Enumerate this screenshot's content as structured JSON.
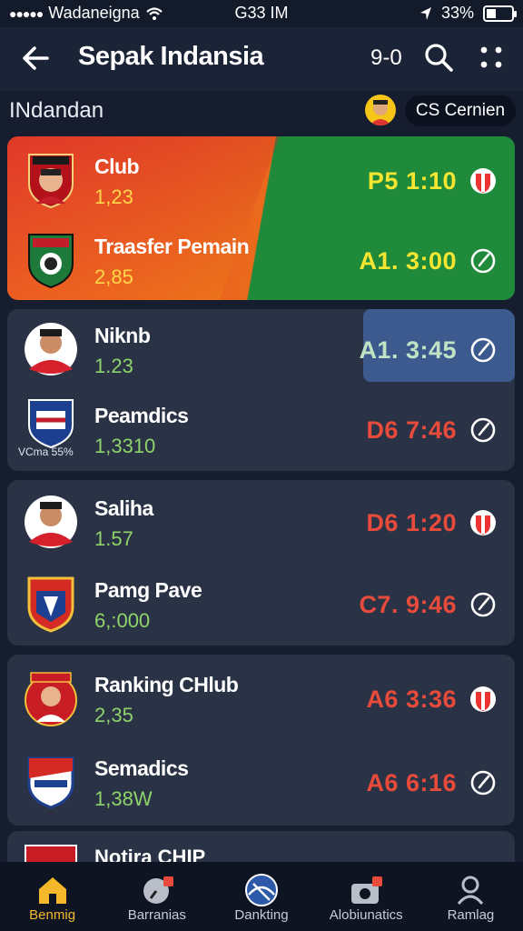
{
  "status_bar": {
    "carrier": "Wadaneigna",
    "time": "G33 IM",
    "battery": "33%"
  },
  "header": {
    "title": "Sepak Indansia",
    "score_chip": "9-0",
    "back_icon": "arrow-left-icon",
    "search_icon": "search-icon",
    "more_icon": "grid-dots-icon"
  },
  "section": {
    "title": "INdandan",
    "chip": "CS Cernien"
  },
  "cards": [
    {
      "featured": true,
      "rows": [
        {
          "name": "Club",
          "sub": "1,23",
          "time": "P5 1:10",
          "icon": "shield-icon"
        },
        {
          "name": "Traasfer Pemain",
          "sub": "2,85",
          "time": "A1. 3:00",
          "icon": "clock-icon"
        }
      ]
    },
    {
      "rows": [
        {
          "name": "Niknb",
          "sub": "1.23",
          "time": "A1. 3:45",
          "icon": "clock-icon",
          "highlight": true
        },
        {
          "name": "Peamdics",
          "sub": "1,3310",
          "time": "D6 7:46",
          "icon": "clock-icon",
          "logo_caption": "VCma 55%"
        }
      ]
    },
    {
      "rows": [
        {
          "name": "Saliha",
          "sub": "1.57",
          "time": "D6 1:20",
          "icon": "shield-icon"
        },
        {
          "name": "Pamg Pave",
          "sub": "6,:000",
          "time": "C7. 9:46",
          "icon": "clock-icon"
        }
      ]
    },
    {
      "rows": [
        {
          "name": "Ranking CHlub",
          "sub": "2,35",
          "time": "A6 3:36",
          "icon": "shield-icon"
        },
        {
          "name": "Semadics",
          "sub": "1,38W",
          "time": "A6 6:16",
          "icon": "clock-icon"
        }
      ]
    }
  ],
  "partial_row": {
    "name": "Notira CHIP"
  },
  "nav": [
    {
      "label": "Benmig",
      "icon": "home-icon",
      "active": true
    },
    {
      "label": "Barranias",
      "icon": "clock-badge-icon"
    },
    {
      "label": "Dankting",
      "icon": "ball-icon"
    },
    {
      "label": "Alobiunatics",
      "icon": "camera-badge-icon"
    },
    {
      "label": "Ramlag",
      "icon": "user-icon"
    }
  ],
  "colors": {
    "background": "#161d2e",
    "card": "#2a3245",
    "time_red": "#e84a3b",
    "time_yellow": "#f6e531",
    "accent": "#f5b82b"
  }
}
